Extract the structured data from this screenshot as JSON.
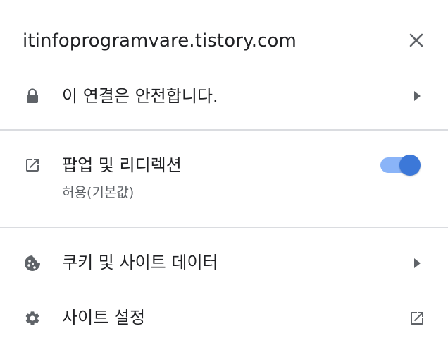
{
  "header": {
    "site_title": "itinfoprogramvare.tistory.com",
    "close_icon": "close-icon"
  },
  "connection": {
    "label": "이 연결은 안전합니다.",
    "icon": "lock-icon",
    "trail_icon": "chevron-right-icon"
  },
  "popups": {
    "label": "팝업 및 리디렉션",
    "sublabel": "허용(기본값)",
    "icon": "open-in-new-icon",
    "toggle_state": "on",
    "accent_color": "#3c78d8"
  },
  "cookies": {
    "label": "쿠키 및 사이트 데이터",
    "icon": "cookie-icon",
    "trail_icon": "chevron-right-icon"
  },
  "site_settings": {
    "label": "사이트 설정",
    "icon": "gear-icon",
    "trail_icon": "open-in-new-icon"
  }
}
